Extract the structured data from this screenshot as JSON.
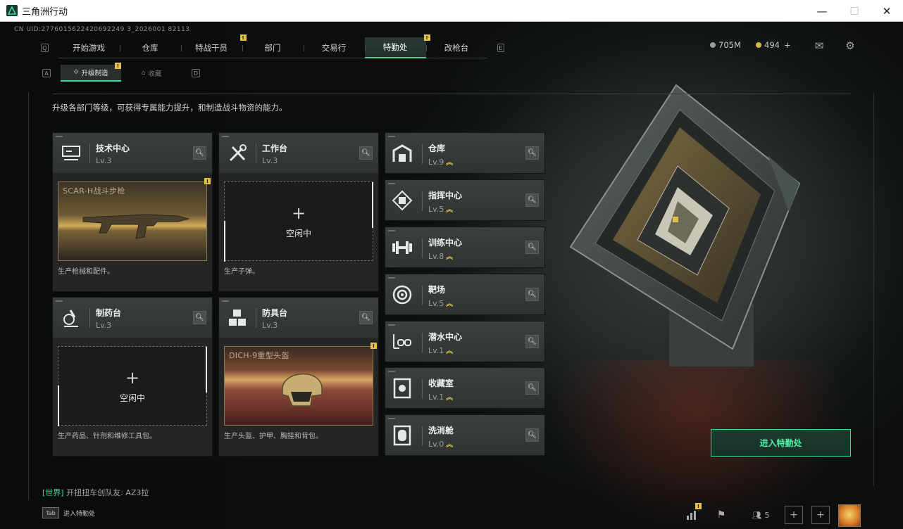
{
  "window": {
    "title": "三角洲行动",
    "minimize": "—",
    "maximize": "☐",
    "close": "✕",
    "icon": "delta-logo-icon"
  },
  "uid": "CN UID:2776015622420692249 3_2026001 82113",
  "nav": {
    "left_key": "Q",
    "right_key": "E",
    "tabs": [
      {
        "label": "开始游戏"
      },
      {
        "label": "仓库"
      },
      {
        "label": "特战干员",
        "badge": "!"
      },
      {
        "label": "部门"
      },
      {
        "label": "交易行"
      },
      {
        "label": "特勤处",
        "badge": "!",
        "active": true
      },
      {
        "label": "改枪台"
      }
    ]
  },
  "currency": {
    "coins": "705M",
    "tickets": "494",
    "tickets_plus": "+"
  },
  "subtabs": {
    "left_key": "A",
    "right_key": "D",
    "items": [
      {
        "label": "升级制造",
        "badge": "!",
        "active": true
      },
      {
        "label": "收藏"
      }
    ]
  },
  "description": "升级各部门等级，可获得专属能力提升，和制造战斗物资的能力。",
  "cards": [
    {
      "name": "技术中心",
      "level": "Lv.3",
      "icon": "monitor-icon",
      "slot": {
        "type": "item",
        "item_name": "SCAR-H战斗步枪",
        "badge": "!"
      },
      "footer": "生产枪械和配件。"
    },
    {
      "name": "工作台",
      "level": "Lv.3",
      "icon": "tools-icon",
      "slot": {
        "type": "empty",
        "plus": "+",
        "label": "空闲中"
      },
      "footer": "生产子弹。"
    },
    {
      "name": "制药台",
      "level": "Lv.3",
      "icon": "microscope-icon",
      "slot": {
        "type": "empty",
        "plus": "+",
        "label": "空闲中"
      },
      "footer": "生产药品、针剂和维修工具包。"
    },
    {
      "name": "防具台",
      "level": "Lv.3",
      "icon": "blocks-icon",
      "slot": {
        "type": "item",
        "item_name": "DICH-9重型头盔",
        "badge": "!"
      },
      "footer": "生产头盔、护甲、胸挂和背包。"
    }
  ],
  "departments": [
    {
      "name": "仓库",
      "level": "Lv.9",
      "icon": "warehouse-icon"
    },
    {
      "name": "指挥中心",
      "level": "Lv.5",
      "icon": "chip-icon"
    },
    {
      "name": "训练中心",
      "level": "Lv.8",
      "icon": "dumbbell-icon"
    },
    {
      "name": "靶场",
      "level": "Lv.5",
      "icon": "target-icon"
    },
    {
      "name": "潜水中心",
      "level": "Lv.1",
      "icon": "diving-mask-icon"
    },
    {
      "name": "收藏室",
      "level": "Lv.1",
      "icon": "vault-icon"
    },
    {
      "name": "洗消舱",
      "level": "Lv.0",
      "icon": "decon-pod-icon"
    }
  ],
  "upgrade_glyph": "︽",
  "enter_button": "进入特勤处",
  "chat": {
    "channel": "[世界]",
    "message": " 开扭扭车创队友: AZ3拉"
  },
  "bottom": {
    "tab_key": "Tab",
    "tab_label": "进入特勤处",
    "friends_count": "5",
    "stats_badge": "!"
  },
  "colors": {
    "accent": "#3fd89a",
    "badge": "#e2c14c"
  }
}
